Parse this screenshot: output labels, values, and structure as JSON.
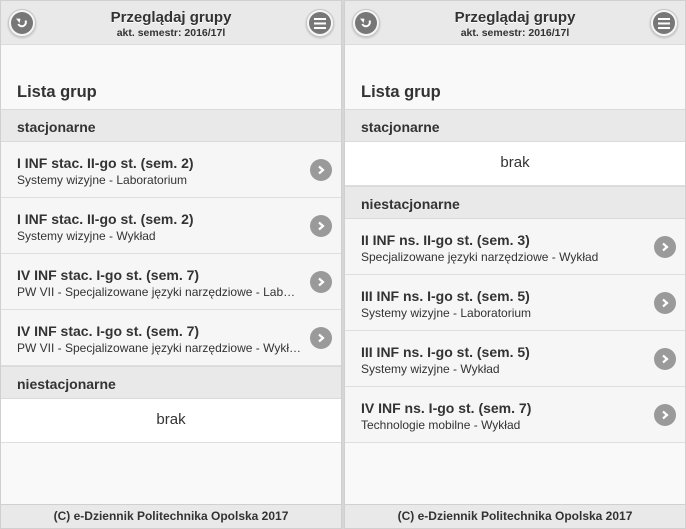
{
  "screens": [
    {
      "header": {
        "title": "Przeglądaj grupy",
        "subtitle": "akt. semestr: 2016/17l"
      },
      "list_title": "Lista grup",
      "sections": [
        {
          "label": "stacjonarne",
          "items": [
            {
              "title": "I INF stac. II-go st. (sem. 2)",
              "subtitle": "Systemy wizyjne - Laboratorium"
            },
            {
              "title": "I INF stac. II-go st. (sem. 2)",
              "subtitle": "Systemy wizyjne - Wykład"
            },
            {
              "title": "IV INF stac. I-go st. (sem. 7)",
              "subtitle": "PW VII - Specjalizowane języki narzędziowe - Laboratorium"
            },
            {
              "title": "IV INF stac. I-go st. (sem. 7)",
              "subtitle": "PW VII - Specjalizowane języki narzędziowe - Wykład"
            }
          ]
        },
        {
          "label": "niestacjonarne",
          "empty_text": "brak",
          "items": []
        }
      ],
      "footer": "(C) e-Dziennik Politechnika Opolska 2017"
    },
    {
      "header": {
        "title": "Przeglądaj grupy",
        "subtitle": "akt. semestr: 2016/17l"
      },
      "list_title": "Lista grup",
      "sections": [
        {
          "label": "stacjonarne",
          "empty_text": "brak",
          "items": []
        },
        {
          "label": "niestacjonarne",
          "items": [
            {
              "title": "II INF ns. II-go st. (sem. 3)",
              "subtitle": "Specjalizowane języki narzędziowe - Wykład"
            },
            {
              "title": "III INF ns. I-go st. (sem. 5)",
              "subtitle": "Systemy wizyjne - Laboratorium"
            },
            {
              "title": "III INF ns. I-go st. (sem. 5)",
              "subtitle": "Systemy wizyjne - Wykład"
            },
            {
              "title": "IV INF ns. I-go st. (sem. 7)",
              "subtitle": "Technologie mobilne - Wykład"
            }
          ]
        }
      ],
      "footer": "(C) e-Dziennik Politechnika Opolska 2017"
    }
  ],
  "icons": {
    "back": "back-arrow-icon",
    "menu": "hamburger-menu-icon",
    "item": "chevron-right-icon"
  }
}
